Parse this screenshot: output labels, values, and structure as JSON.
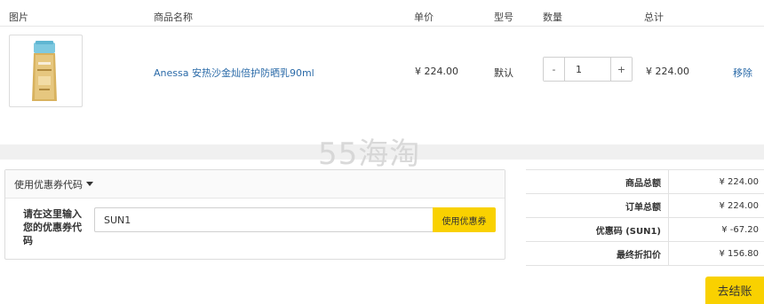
{
  "cart": {
    "columns": {
      "image": "图片",
      "name": "商品名称",
      "unit_price": "单价",
      "model": "型号",
      "quantity": "数量",
      "total": "总计"
    },
    "item": {
      "image_icon": "sunscreen-bottle-icon",
      "name": "Anessa 安热沙金灿倍护防晒乳90ml",
      "unit_price": "¥ 224.00",
      "model": "默认",
      "qty_minus": "-",
      "quantity": "1",
      "qty_plus": "+",
      "total": "¥ 224.00",
      "remove_label": "移除"
    }
  },
  "watermark": "55海淘",
  "coupon": {
    "toggle_label": "使用优惠券代码",
    "input_label": "请在这里输入您的优惠券代码",
    "input_value": "SUN1",
    "apply_label": "使用优惠券"
  },
  "summary": {
    "rows": [
      {
        "label": "商品总额",
        "value": "¥ 224.00"
      },
      {
        "label": "订单总额",
        "value": "¥ 224.00"
      },
      {
        "label": "优惠码 (SUN1)",
        "value": "¥ -67.20"
      },
      {
        "label": "最终折扣价",
        "value": "¥ 156.80"
      }
    ]
  },
  "checkout_label": "去结账",
  "colors": {
    "accent_yellow": "#f9d100",
    "link_blue": "#2a6aa8"
  }
}
